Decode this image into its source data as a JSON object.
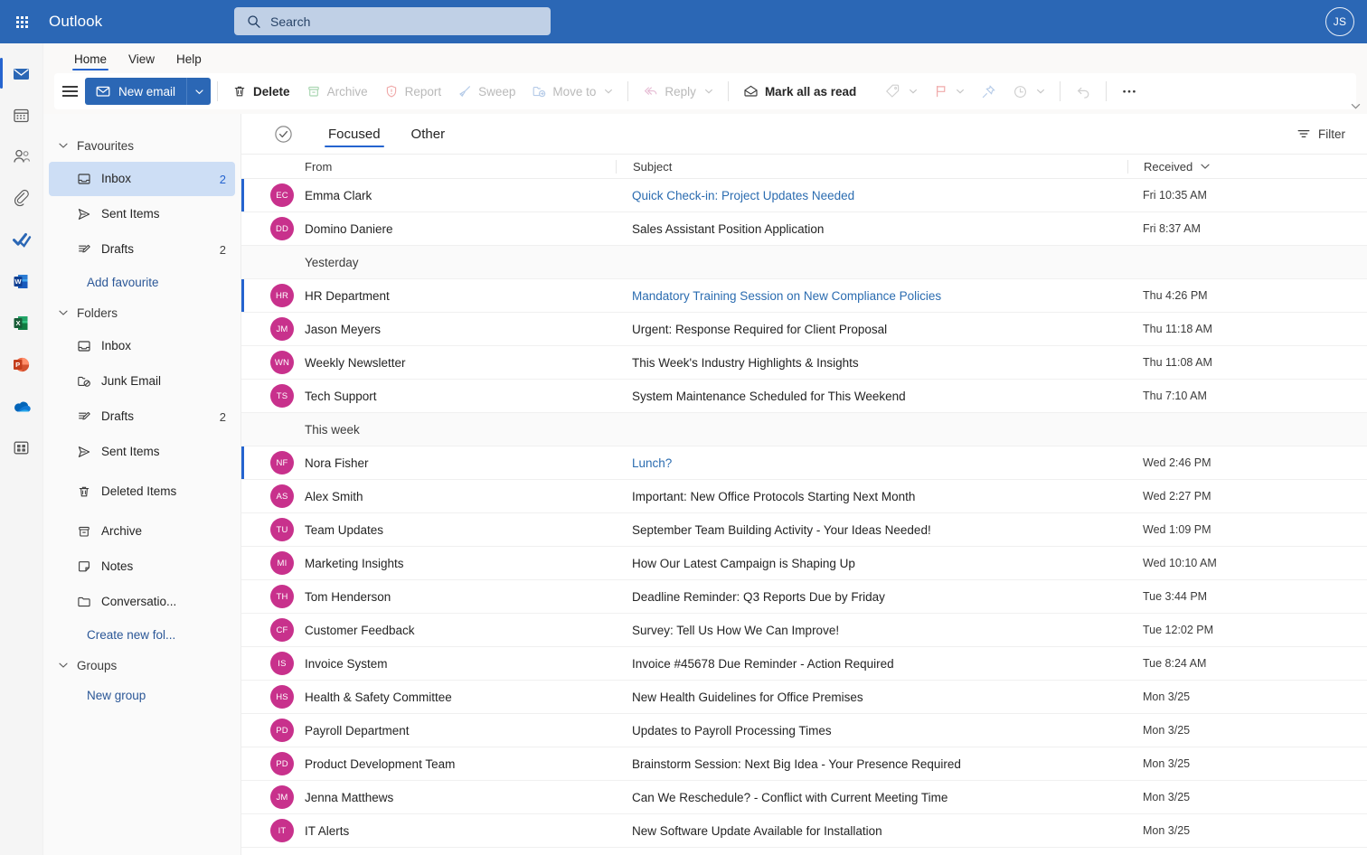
{
  "topbar": {
    "brand": "Outlook",
    "search_placeholder": "Search",
    "search_value": "",
    "account_initials": "JS"
  },
  "ribbon_tabs": [
    {
      "label": "Home",
      "selected": true
    },
    {
      "label": "View",
      "selected": false
    },
    {
      "label": "Help",
      "selected": false
    }
  ],
  "ribbon": {
    "new_email": "New email",
    "buttons": [
      {
        "label": "Delete",
        "icon": "trash-icon",
        "disabled": false,
        "strong": true,
        "caret": false
      },
      {
        "label": "Archive",
        "icon": "archive-icon",
        "disabled": true,
        "strong": false,
        "caret": false
      },
      {
        "label": "Report",
        "icon": "report-shield-icon",
        "disabled": true,
        "strong": false,
        "caret": false
      },
      {
        "label": "Sweep",
        "icon": "sweep-broom-icon",
        "disabled": true,
        "strong": false,
        "caret": false
      },
      {
        "label": "Move to",
        "icon": "move-to-folder-icon",
        "disabled": true,
        "strong": false,
        "caret": true
      },
      {
        "label": "Reply",
        "icon": "reply-arrow-icon",
        "disabled": true,
        "strong": false,
        "caret": true
      },
      {
        "label": "Mark all as read",
        "icon": "open-envelope-icon",
        "disabled": false,
        "strong": true,
        "caret": false
      }
    ],
    "icon_only": [
      {
        "icon": "tag-icon",
        "caret": true
      },
      {
        "icon": "flag-icon",
        "caret": true
      },
      {
        "icon": "pin-icon",
        "caret": false
      },
      {
        "icon": "clock-snooze-icon",
        "caret": true
      },
      {
        "icon": "undo-icon",
        "caret": false
      },
      {
        "icon": "more-ellipsis-icon",
        "caret": false
      }
    ]
  },
  "rail": [
    {
      "name": "mail",
      "active": true
    },
    {
      "name": "calendar",
      "active": false
    },
    {
      "name": "people",
      "active": false
    },
    {
      "name": "attachments",
      "active": false
    },
    {
      "name": "todo",
      "active": false
    },
    {
      "name": "word",
      "active": false
    },
    {
      "name": "excel",
      "active": false
    },
    {
      "name": "powerpoint",
      "active": false
    },
    {
      "name": "onedrive",
      "active": false
    },
    {
      "name": "all-apps",
      "active": false
    }
  ],
  "folder_pane": {
    "favourites": {
      "title": "Favourites",
      "items": [
        {
          "label": "Inbox",
          "icon": "inbox-icon",
          "count": "2",
          "selected": true
        },
        {
          "label": "Sent Items",
          "icon": "send-icon",
          "count": "",
          "selected": false
        },
        {
          "label": "Drafts",
          "icon": "drafts-pencil-icon",
          "count": "2",
          "selected": false
        }
      ],
      "add_link": "Add favourite"
    },
    "folders": {
      "title": "Folders",
      "items": [
        {
          "label": "Inbox",
          "icon": "inbox-icon",
          "count": "",
          "selected": false
        },
        {
          "label": "Junk Email",
          "icon": "junk-folder-icon",
          "count": "",
          "selected": false
        },
        {
          "label": "Drafts",
          "icon": "drafts-pencil-icon",
          "count": "2",
          "selected": false
        },
        {
          "label": "Sent Items",
          "icon": "send-icon",
          "count": "",
          "selected": false
        },
        {
          "label": "Deleted Items",
          "icon": "trash-icon",
          "count": "",
          "selected": false
        },
        {
          "label": "Archive",
          "icon": "archive-icon",
          "count": "",
          "selected": false
        },
        {
          "label": "Notes",
          "icon": "note-icon",
          "count": "",
          "selected": false
        },
        {
          "label": "Conversatio...",
          "icon": "folder-icon",
          "count": "",
          "selected": false
        }
      ],
      "create_link": "Create new fol..."
    },
    "groups": {
      "title": "Groups",
      "new_link": "New group"
    }
  },
  "list": {
    "tabs": [
      {
        "label": "Focused",
        "selected": true
      },
      {
        "label": "Other",
        "selected": false
      }
    ],
    "filter_label": "Filter",
    "columns": {
      "from": "From",
      "subject": "Subject",
      "received": "Received"
    },
    "rows": [
      {
        "kind": "mail",
        "initials": "EC",
        "from": "Emma Clark",
        "subject": "Quick Check-in: Project Updates Needed",
        "received": "Fri 10:35 AM",
        "unread": true
      },
      {
        "kind": "mail",
        "initials": "DD",
        "from": "Domino Daniere",
        "subject": "Sales Assistant Position Application",
        "received": "Fri 8:37 AM",
        "unread": false
      },
      {
        "kind": "date",
        "label": "Yesterday"
      },
      {
        "kind": "mail",
        "initials": "HR",
        "from": "HR Department",
        "subject": "Mandatory Training Session on New Compliance Policies",
        "received": "Thu 4:26 PM",
        "unread": true
      },
      {
        "kind": "mail",
        "initials": "JM",
        "from": "Jason Meyers",
        "subject": "Urgent: Response Required for Client Proposal",
        "received": "Thu 11:18 AM",
        "unread": false
      },
      {
        "kind": "mail",
        "initials": "WN",
        "from": "Weekly Newsletter",
        "subject": "This Week's Industry Highlights & Insights",
        "received": "Thu 11:08 AM",
        "unread": false
      },
      {
        "kind": "mail",
        "initials": "TS",
        "from": "Tech Support",
        "subject": "System Maintenance Scheduled for This Weekend",
        "received": "Thu 7:10 AM",
        "unread": false
      },
      {
        "kind": "date",
        "label": "This week"
      },
      {
        "kind": "mail",
        "initials": "NF",
        "from": "Nora Fisher",
        "subject": "Lunch?",
        "received": "Wed 2:46 PM",
        "unread": true
      },
      {
        "kind": "mail",
        "initials": "AS",
        "from": "Alex Smith",
        "subject": "Important: New Office Protocols Starting Next Month",
        "received": "Wed 2:27 PM",
        "unread": false
      },
      {
        "kind": "mail",
        "initials": "TU",
        "from": "Team Updates",
        "subject": "September Team Building Activity - Your Ideas Needed!",
        "received": "Wed 1:09 PM",
        "unread": false
      },
      {
        "kind": "mail",
        "initials": "MI",
        "from": "Marketing Insights",
        "subject": "How Our Latest Campaign is Shaping Up",
        "received": "Wed 10:10 AM",
        "unread": false
      },
      {
        "kind": "mail",
        "initials": "TH",
        "from": "Tom Henderson",
        "subject": "Deadline Reminder: Q3 Reports Due by Friday",
        "received": "Tue 3:44 PM",
        "unread": false
      },
      {
        "kind": "mail",
        "initials": "CF",
        "from": "Customer Feedback",
        "subject": "Survey: Tell Us How We Can Improve!",
        "received": "Tue 12:02 PM",
        "unread": false
      },
      {
        "kind": "mail",
        "initials": "IS",
        "from": "Invoice System",
        "subject": "Invoice #45678 Due Reminder - Action Required",
        "received": "Tue 8:24 AM",
        "unread": false
      },
      {
        "kind": "mail",
        "initials": "HS",
        "from": "Health & Safety Committee",
        "subject": "New Health Guidelines for Office Premises",
        "received": "Mon 3/25",
        "unread": false
      },
      {
        "kind": "mail",
        "initials": "PD",
        "from": "Payroll Department",
        "subject": "Updates to Payroll Processing Times",
        "received": "Mon 3/25",
        "unread": false
      },
      {
        "kind": "mail",
        "initials": "PD",
        "from": "Product Development Team",
        "subject": "Brainstorm Session: Next Big Idea - Your Presence Required",
        "received": "Mon 3/25",
        "unread": false
      },
      {
        "kind": "mail",
        "initials": "JM",
        "from": "Jenna Matthews",
        "subject": "Can We Reschedule? - Conflict with Current Meeting Time",
        "received": "Mon 3/25",
        "unread": false
      },
      {
        "kind": "mail",
        "initials": "IT",
        "from": "IT Alerts",
        "subject": "New Software Update Available for Installation",
        "received": "Mon 3/25",
        "unread": false
      }
    ]
  },
  "colors": {
    "brand_blue": "#2b67b5",
    "accent_blue": "#2564cf",
    "avatar_pink": "#c8318c",
    "unread_subject": "#2b6cb0",
    "link_blue": "#2b5797",
    "selected_row": "#cddef5"
  }
}
